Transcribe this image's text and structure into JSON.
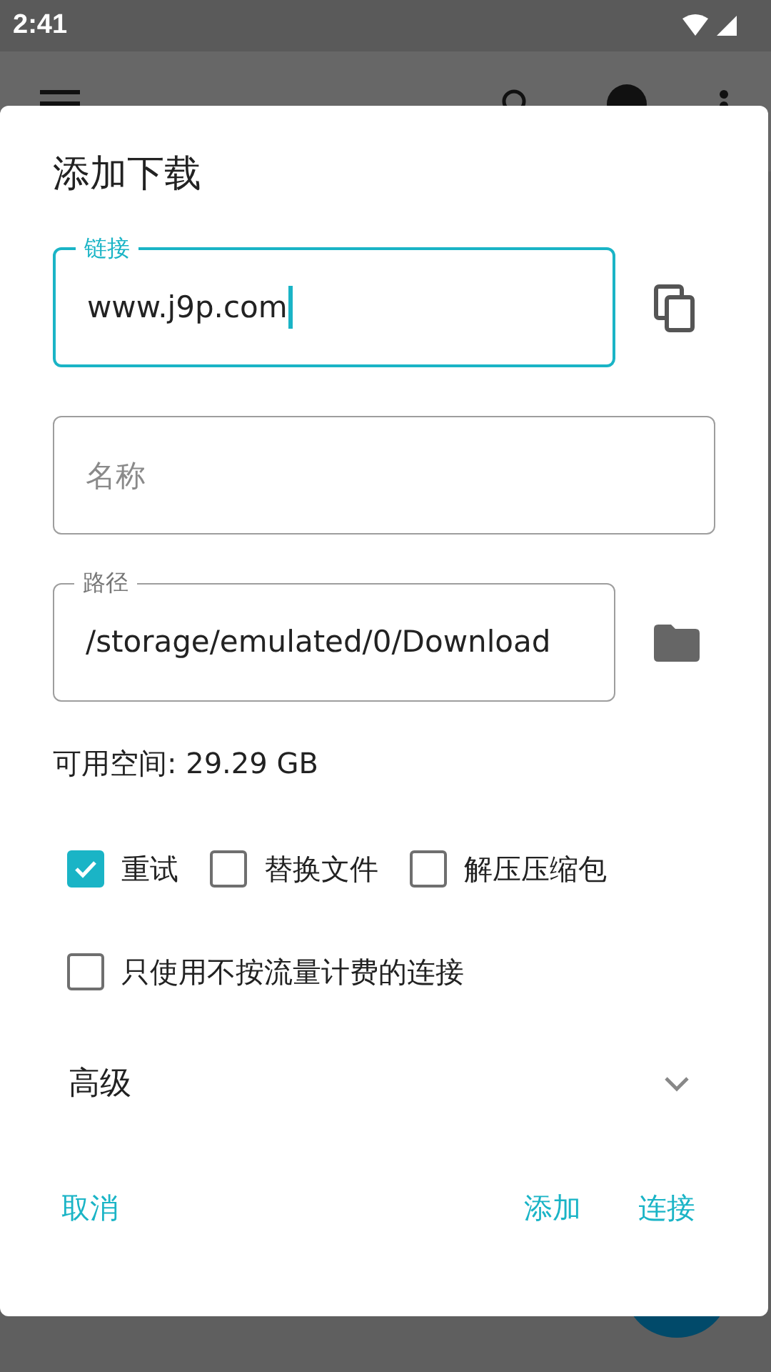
{
  "status_bar": {
    "time": "2:41"
  },
  "dialog": {
    "title": "添加下载",
    "fields": [
      {
        "label": "链接",
        "value": "www.j9p.com",
        "focused": true
      },
      {
        "placeholder": "名称"
      },
      {
        "label": "路径",
        "value": "/storage/emulated/0/Download",
        "focused": false
      }
    ],
    "free_space": "可用空间: 29.29 GB",
    "option_rows": [
      [
        {
          "label": "重试",
          "checked": true
        },
        {
          "label": "替换文件",
          "checked": false
        },
        {
          "label": "解压压缩包",
          "checked": false
        }
      ],
      [
        {
          "label": "只使用不按流量计费的连接",
          "checked": false
        }
      ]
    ],
    "advanced": {
      "label": "高级",
      "expanded": false
    },
    "buttons": [
      {
        "label": "取消"
      },
      {
        "label": "添加"
      },
      {
        "label": "连接"
      }
    ]
  }
}
